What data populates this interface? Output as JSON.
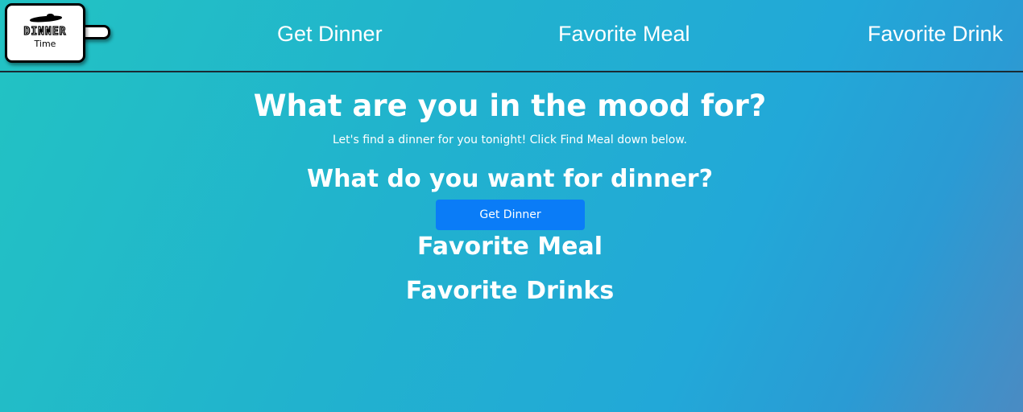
{
  "logo": {
    "word": "DINNER",
    "sub": "Time"
  },
  "nav": {
    "items": [
      {
        "label": "Get Dinner"
      },
      {
        "label": "Favorite Meal"
      },
      {
        "label": "Favorite Drink"
      }
    ]
  },
  "main": {
    "title": "What are you in the mood for?",
    "subtitle": "Let's find a dinner for you tonight! Click Find Meal down below.",
    "question": "What do you want for dinner?",
    "button_label": "Get Dinner",
    "favorite_meal": "Favorite Meal",
    "favorite_drinks": "Favorite Drinks"
  },
  "colors": {
    "gradient_start": "#22c3c3",
    "gradient_end": "#4a8bc3",
    "button": "#0a7cf7",
    "text": "#ffffff"
  }
}
